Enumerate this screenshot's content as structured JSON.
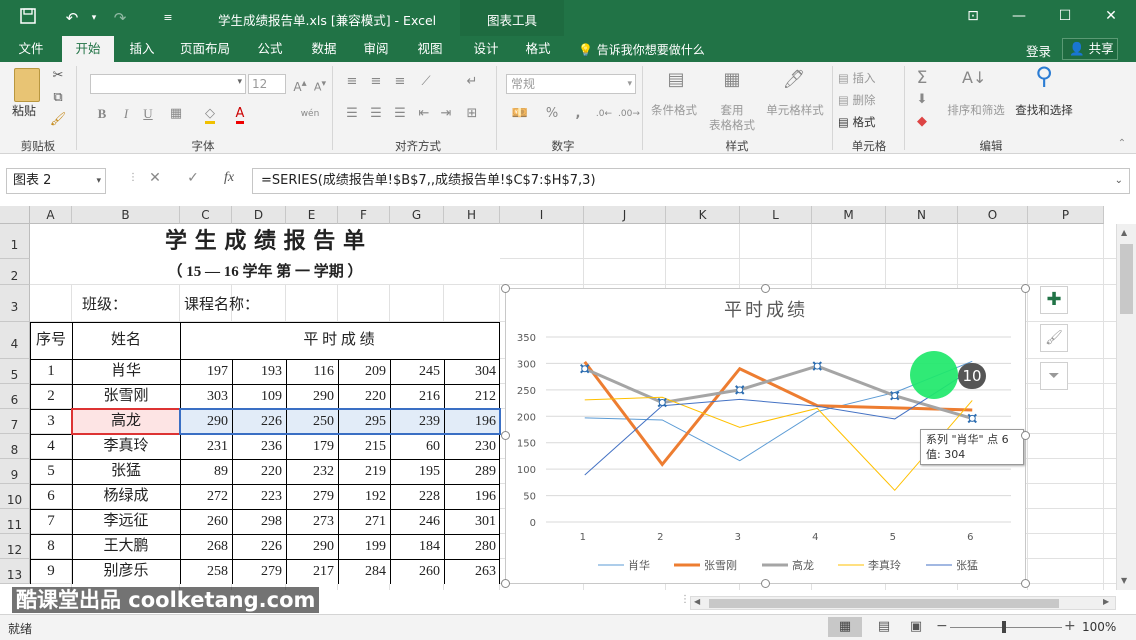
{
  "window": {
    "title": "学生成绩报告单.xls  [兼容模式] - Excel",
    "context_tab_group": "图表工具",
    "signin": "登录",
    "share": "共享",
    "tell_me": "告诉我你想要做什么"
  },
  "ribbon_tabs": [
    "文件",
    "开始",
    "插入",
    "页面布局",
    "公式",
    "数据",
    "审阅",
    "视图",
    "设计",
    "格式"
  ],
  "ribbon": {
    "paste": "粘贴",
    "groups": {
      "clipboard": "剪贴板",
      "font": "字体",
      "alignment": "对齐方式",
      "number": "数字",
      "styles": "样式",
      "cells": "单元格",
      "editing": "编辑"
    },
    "font_size": "12",
    "number_format": "常规",
    "conditional_format": "条件格式",
    "format_table_1": "套用",
    "format_table_2": "表格格式",
    "cell_styles": "单元格样式",
    "insert": "插入",
    "delete": "删除",
    "format": "格式",
    "sort_filter": "排序和筛选",
    "find_select": "查找和选择",
    "bold": "B",
    "italic": "I",
    "underline": "U",
    "percent": "%",
    "comma": ","
  },
  "formula_bar": {
    "name_box": "图表 2",
    "fx": "fx",
    "formula": "=SERIES(成绩报告单!$B$7,,成绩报告单!$C$7:$H$7,3)"
  },
  "sheet": {
    "columns": [
      "A",
      "B",
      "C",
      "D",
      "E",
      "F",
      "G",
      "H",
      "I",
      "J",
      "K",
      "L",
      "M",
      "N",
      "O",
      "P"
    ],
    "rows": [
      "1",
      "2",
      "3",
      "4",
      "5",
      "6",
      "7",
      "8",
      "9",
      "10",
      "11",
      "12",
      "13"
    ],
    "title": "学 生 成 绩 报 告 单",
    "subtitle": "（ 15 — 16    学年 第 一 学期 ）",
    "class_label": "班级：",
    "course_label": "课程名称：",
    "hdr_no": "序号",
    "hdr_name": "姓名",
    "hdr_scores": "平 时 成 绩",
    "students": [
      {
        "no": "1",
        "name": "肖华",
        "s": [
          "197",
          "193",
          "116",
          "209",
          "245",
          "304"
        ]
      },
      {
        "no": "2",
        "name": "张雪刚",
        "s": [
          "303",
          "109",
          "290",
          "220",
          "216",
          "212"
        ]
      },
      {
        "no": "3",
        "name": "高龙",
        "s": [
          "290",
          "226",
          "250",
          "295",
          "239",
          "196"
        ]
      },
      {
        "no": "4",
        "name": "李真玲",
        "s": [
          "231",
          "236",
          "179",
          "215",
          "60",
          "230"
        ]
      },
      {
        "no": "5",
        "name": "张猛",
        "s": [
          "89",
          "220",
          "232",
          "219",
          "195",
          "289"
        ]
      },
      {
        "no": "6",
        "name": "杨绿成",
        "s": [
          "272",
          "223",
          "279",
          "192",
          "228",
          "196"
        ]
      },
      {
        "no": "7",
        "name": "李远征",
        "s": [
          "260",
          "298",
          "273",
          "271",
          "246",
          "301"
        ]
      },
      {
        "no": "8",
        "name": "王大鹏",
        "s": [
          "268",
          "226",
          "290",
          "199",
          "184",
          "280"
        ]
      },
      {
        "no": "9",
        "name": "别彦乐",
        "s": [
          "258",
          "279",
          "217",
          "284",
          "260",
          "263"
        ]
      }
    ]
  },
  "chart_data": {
    "type": "line",
    "title": "平时成绩",
    "categories": [
      "1",
      "2",
      "3",
      "4",
      "5",
      "6"
    ],
    "ylim": [
      0,
      350
    ],
    "yticks": [
      "0",
      "50",
      "100",
      "150",
      "200",
      "250",
      "300",
      "350"
    ],
    "series": [
      {
        "name": "肖华",
        "color": "#5b9bd5",
        "values": [
          197,
          193,
          116,
          209,
          245,
          304
        ]
      },
      {
        "name": "张雪刚",
        "color": "#ed7d31",
        "values": [
          303,
          109,
          290,
          220,
          216,
          212
        ]
      },
      {
        "name": "高龙",
        "color": "#a5a5a5",
        "values": [
          290,
          226,
          250,
          295,
          239,
          196
        ]
      },
      {
        "name": "李真玲",
        "color": "#ffc000",
        "values": [
          231,
          236,
          179,
          215,
          60,
          230
        ]
      },
      {
        "name": "张猛",
        "color": "#4472c4",
        "values": [
          89,
          220,
          232,
          219,
          195,
          289
        ]
      }
    ],
    "legend_position": "bottom",
    "gridlines": true,
    "tooltip_line1": "系列 \"肖华\" 点 6",
    "tooltip_line2": "值: 304",
    "step_badge": "10"
  },
  "status": {
    "ready": "就绪",
    "zoom": "100%",
    "minus": "−",
    "plus": "+"
  },
  "watermark": "酷课堂出品 coolketang.com"
}
